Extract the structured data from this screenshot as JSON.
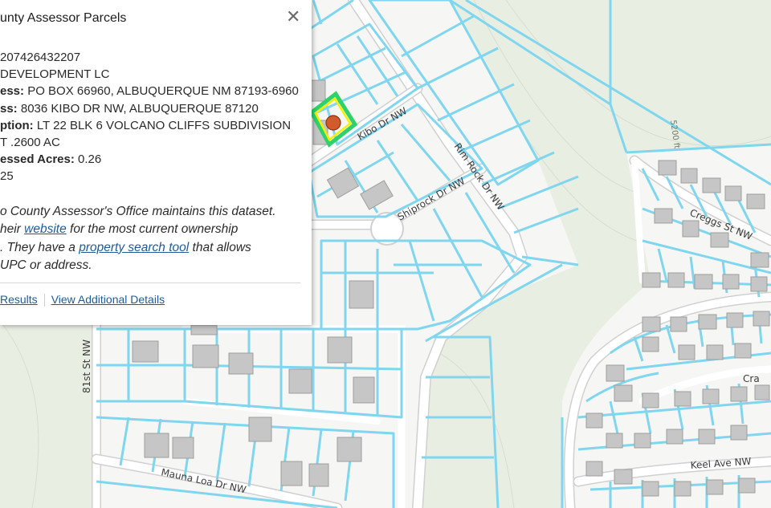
{
  "popup": {
    "title": "unty Assessor Parcels",
    "fields": [
      {
        "label": "",
        "value": "207426432207"
      },
      {
        "label": "",
        "value": " DEVELOPMENT LC"
      },
      {
        "label": "ess:",
        "value": " PO BOX 66960, ALBUQUERQUE NM 87193-6960"
      },
      {
        "label": "ss:",
        "value": "  8036 KIBO DR NW, ALBUQUERQUE 87120"
      },
      {
        "label": "ption:",
        "value": " LT 22 BLK 6 VOLCANO CLIFFS SUBDIVISION"
      },
      {
        "label": "",
        "value": "T .2600 AC"
      },
      {
        "label": "essed Acres:",
        "value": " 0.26"
      },
      {
        "label": "",
        "value": "25"
      }
    ],
    "note": {
      "line1": "o County Assessor's Office maintains this dataset.",
      "line2_pre": "heir ",
      "line2_link": "website",
      "line2_post": " for the most current ownership",
      "line3_pre": ". They have a ",
      "line3_link": "property search tool",
      "line3_post": " that allows",
      "line4": "UPC or address."
    },
    "actions": {
      "results": "Results",
      "details": "View Additional Details"
    }
  },
  "map": {
    "colors": {
      "background": "#e9eee3",
      "lot_fill": "#f6f7f4",
      "parcel_line": "#7fd6ee",
      "road": "#ffffff",
      "road_edge": "#d0d0d0",
      "building": "#c6c6c6",
      "selection_outer": "#2fd26a",
      "selection_inner": "#f4f000",
      "marker": "#d35a2a"
    },
    "street_labels": {
      "kibo": "Kibo Dr NW",
      "rim_rock": "Rim Rock Dr NW",
      "shiprock": "Shiprock Dr NW",
      "first81": "81st St NW",
      "mauna_loa": "Mauna Loa Dr NW",
      "creggs": "Creggs St NW",
      "keel": "Keel Ave NW",
      "cra": "Cra"
    },
    "contour_label": "5200 ft"
  }
}
